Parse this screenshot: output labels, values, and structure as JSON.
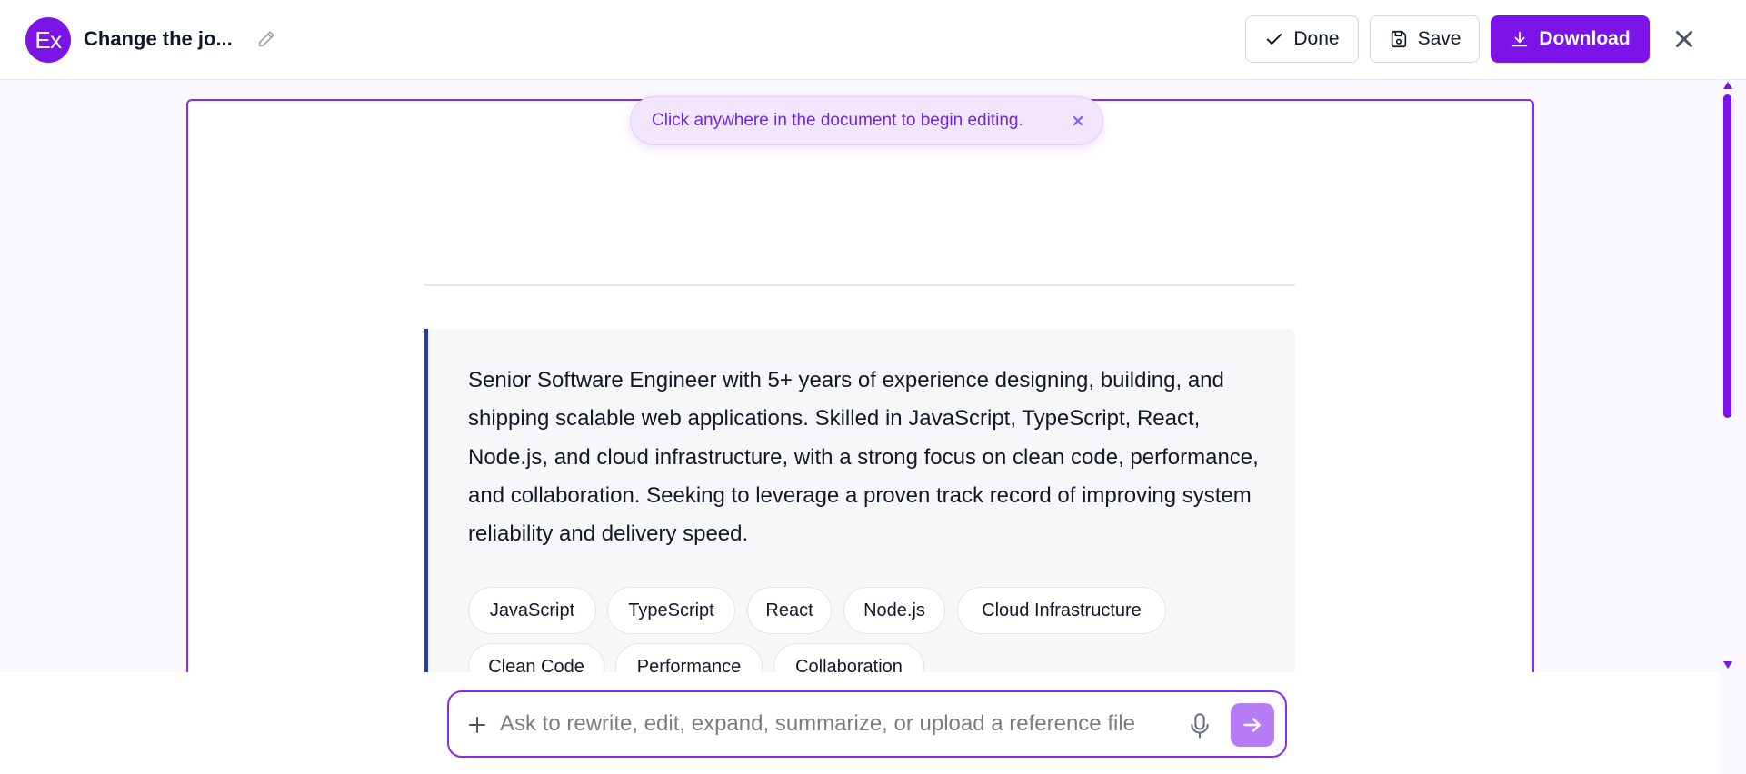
{
  "header": {
    "avatar_text": "Ex",
    "doc_title": "Change the jo...",
    "done_label": "Done",
    "save_label": "Save",
    "download_label": "Download"
  },
  "toast": {
    "message": "Click anywhere in the document to begin editing."
  },
  "document": {
    "summary": "Senior Software Engineer with 5+ years of experience designing, building, and shipping scalable web applications. Skilled in JavaScript, TypeScript, React, Node.js, and cloud infrastructure, with a strong focus on clean code, performance, and collaboration. Seeking to leverage a proven track record of improving system reliability and delivery speed.",
    "tags": [
      "JavaScript",
      "TypeScript",
      "React",
      "Node.js",
      "Cloud Infrastructure",
      "Clean Code",
      "Performance",
      "Collaboration"
    ]
  },
  "chat": {
    "placeholder": "Ask to rewrite, edit, expand, summarize, or upload a reference file"
  },
  "colors": {
    "accent": "#7c14e8",
    "accent_light": "#f1e6fd",
    "quote_border": "#1e40af",
    "send_button": "#b57cf6"
  },
  "icons": {
    "edit": "pencil-icon",
    "done": "check-icon",
    "save": "floppy-disk-icon",
    "download": "download-icon",
    "close": "close-icon",
    "attach": "plus-icon",
    "voice": "microphone-icon",
    "send": "arrow-right-icon"
  }
}
